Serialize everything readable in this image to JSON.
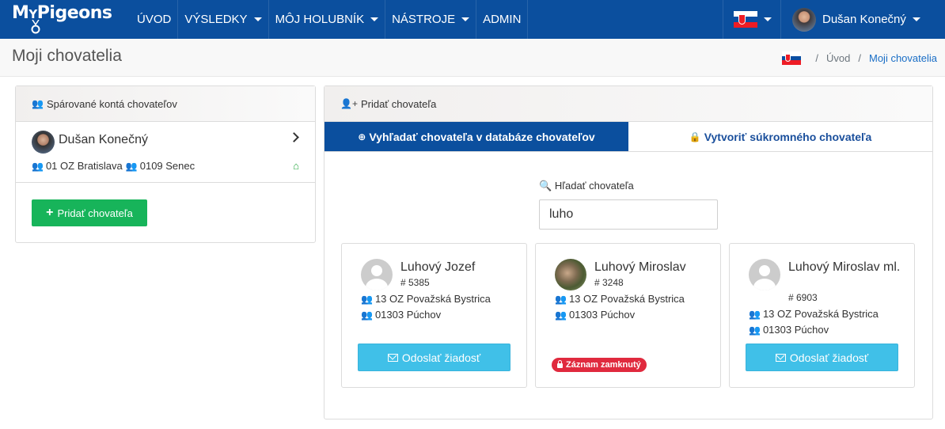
{
  "nav": {
    "brand_m": "M",
    "brand_y": "Y",
    "brand_rest": "Pigeons",
    "items": [
      {
        "label": "ÚVOD"
      },
      {
        "label": "VÝSLEDKY"
      },
      {
        "label": "MÔJ HOLUBNÍK"
      },
      {
        "label": "NÁSTROJE"
      },
      {
        "label": "ADMIN"
      }
    ],
    "user_name": "Dušan Konečný"
  },
  "page": {
    "title": "Moji chovatelia",
    "breadcrumb": [
      "Úvod",
      "Moji chovatelia"
    ]
  },
  "left": {
    "header": "Spárované kontá chovateľov",
    "breeder": {
      "name": "Dušan Konečný",
      "region": "01 OZ Bratislava",
      "club": "0109 Senec"
    },
    "add_button": "Pridať chovateľa"
  },
  "right": {
    "header": "Pridať chovateľa",
    "tab_search": "Vyhľadať chovateľa v databáze chovateľov",
    "tab_private": "Vytvoriť súkromného chovateľa",
    "search_label": "Hľadať chovateľa",
    "search_value": "luho",
    "results": [
      {
        "name": "Luhový Jozef",
        "id": "# 5385",
        "region": "13 OZ Považská Bystrica",
        "club": "01303 Púchov",
        "action": "Odoslať žiadosť"
      },
      {
        "name": "Luhový Miroslav",
        "id": "# 3248",
        "region": "13 OZ Považská Bystrica",
        "club": "01303 Púchov",
        "locked": "Záznam zamknutý"
      },
      {
        "name": "Luhový Miroslav ml.",
        "id": "# 6903",
        "region": "13 OZ Považská Bystrica",
        "club": "01303 Púchov",
        "action": "Odoslať žiadosť"
      }
    ]
  },
  "colors": {
    "navbar": "#0b4f9e",
    "success": "#17b45a",
    "info": "#40c0e8",
    "danger": "#e02a3e",
    "purple": "#a05ad7",
    "blue": "#2f8ae3"
  }
}
